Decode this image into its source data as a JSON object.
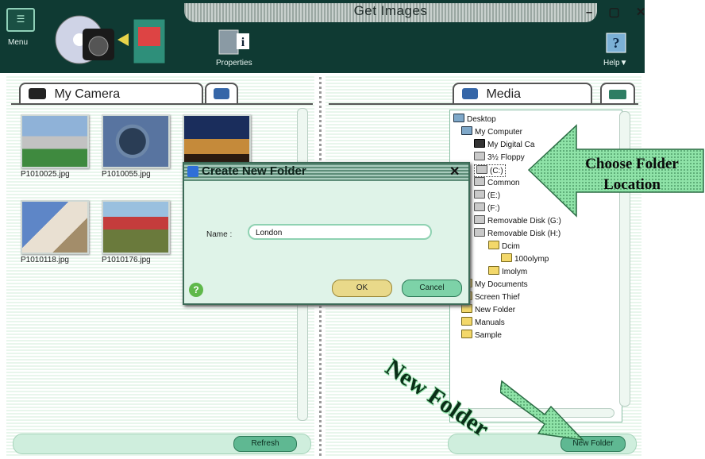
{
  "window": {
    "title": "Get Images",
    "controls": "– ▢ ✕",
    "menu_label": "Menu",
    "properties_label": "Properties",
    "help_label": "Help▼"
  },
  "left_panel": {
    "tab_label": "My Camera",
    "photos": [
      {
        "file": "P1010025.jpg"
      },
      {
        "file": "P1010055.jpg"
      },
      {
        "file": "P1010118.jpg"
      },
      {
        "file": "P1010176.jpg"
      }
    ],
    "refresh_label": "Refresh"
  },
  "right_panel": {
    "tab_label": "Media",
    "new_folder_label": "New Folder",
    "tree": [
      "Desktop",
      "My Computer",
      "My Digital Ca",
      "3½ Floppy",
      "(C:)",
      "Common",
      "(E:)",
      "(F:)",
      "Removable Disk (G:)",
      "Removable Disk (H:)",
      "Dcim",
      "100olymp",
      "Imolym",
      "My Documents",
      "Screen Thief",
      "New Folder",
      "Manuals",
      "Sample"
    ]
  },
  "dialog": {
    "title": "Create New Folder",
    "close": "✕",
    "name_label": "Name :",
    "name_value": "London",
    "ok_label": "OK",
    "cancel_label": "Cancel",
    "help_glyph": "?"
  },
  "annotations": {
    "choose_folder_line1": "Choose Folder",
    "choose_folder_line2": "Location",
    "new_folder_callout": "New Folder"
  },
  "colors": {
    "title_bar": "#0f3a33",
    "accent_green": "#5fb892",
    "callout_green": "#7fd89b"
  }
}
